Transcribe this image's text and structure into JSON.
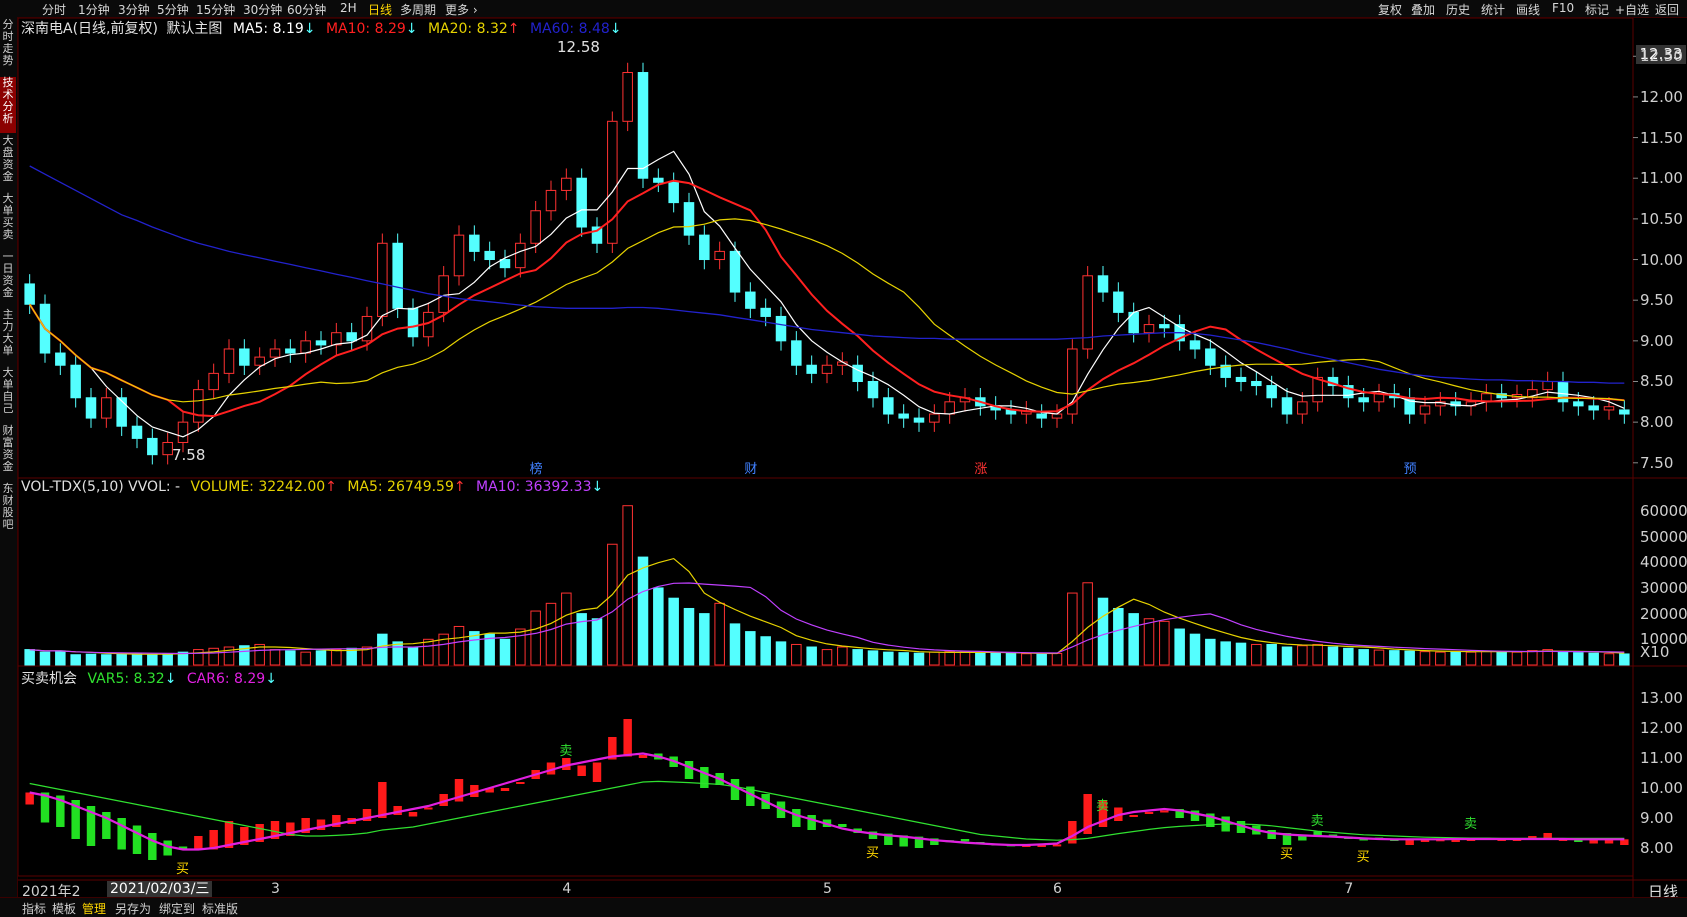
{
  "toolbar": {
    "left_tabs": [
      "分时",
      "1分钟",
      "3分钟",
      "5分钟",
      "15分钟",
      "30分钟",
      "60分钟",
      "2H",
      "日线",
      "多周期",
      "更多 ›"
    ],
    "active_tab": "日线",
    "right_buttons": [
      "复权",
      "叠加",
      "历史",
      "统计",
      "画线",
      "F10",
      "标记",
      "+自选",
      "返回"
    ]
  },
  "sidebar": {
    "items": [
      "分时走势",
      "技术分析",
      "大盘资金",
      "大单买卖",
      "一日资金",
      "主力大单",
      "大单自己",
      "财富资金",
      "东财股吧"
    ],
    "active": "技术分析"
  },
  "main_panel": {
    "stock_label": "深南电A(日线,前复权)",
    "theme_label": "默认主图",
    "ma5": "MA5: 8.19",
    "ma10": "MA10: 8.29",
    "ma20": "MA20: 8.32",
    "ma60": "MA60: 8.48",
    "max_label": "12.58",
    "min_label": "7.58",
    "current_price": "12.33",
    "y_ticks": [
      "12.50",
      "12.00",
      "11.50",
      "11.00",
      "10.50",
      "10.00",
      "9.50",
      "9.00",
      "8.50",
      "8.00",
      "7.50"
    ],
    "event_tags": [
      "榜",
      "财",
      "涨",
      "预"
    ]
  },
  "volume_panel": {
    "indicator": "VOL-TDX(5,10) VVOL: -",
    "volume": "VOLUME: 32242.00",
    "ma5": "MA5: 26749.59",
    "ma10": "MA10: 36392.33",
    "y_ticks": [
      "60000",
      "50000",
      "40000",
      "30000",
      "20000",
      "10000",
      "X10"
    ]
  },
  "signal_panel": {
    "indicator": "买卖机会",
    "var5": "VAR5: 8.32",
    "car6": "CAR6: 8.29",
    "y_ticks": [
      "13.00",
      "12.00",
      "11.00",
      "10.00",
      "9.00",
      "8.00"
    ],
    "buy_label": "买",
    "sell_label": "卖"
  },
  "x_axis": {
    "date_box": "2021/02/03/三",
    "labels": [
      "2021年2",
      "3",
      "4",
      "5",
      "6",
      "7"
    ],
    "period": "日线"
  },
  "bottom_bar": {
    "items": [
      "指标",
      "模板",
      "管理",
      "另存为",
      "绑定到",
      "标准版"
    ]
  },
  "colors": {
    "up": "#ff3232",
    "down": "#54ffff",
    "ma5": "#ffffff",
    "ma10": "#ff2020",
    "ma20": "#e6d200",
    "ma60": "#2222cc",
    "vol_ma5": "#e6d200",
    "vol_ma10": "#c040ff",
    "var5": "#30e030",
    "car6": "#e020e0",
    "grid": "#5a0000"
  },
  "chart_data": [
    {
      "type": "candlestick",
      "title": "深南电A(日线,前复权)",
      "y_range": [
        7.35,
        12.7
      ],
      "max": 12.58,
      "min": 7.58,
      "close": [
        9.45,
        8.85,
        8.7,
        8.3,
        8.05,
        8.3,
        7.95,
        7.8,
        7.6,
        7.75,
        8.0,
        8.4,
        8.6,
        8.9,
        8.7,
        8.8,
        8.9,
        8.85,
        9.0,
        8.95,
        9.1,
        9.0,
        9.3,
        10.2,
        9.4,
        9.05,
        9.35,
        9.8,
        10.3,
        10.1,
        10.0,
        9.9,
        10.2,
        10.6,
        10.85,
        11.0,
        10.4,
        10.2,
        11.7,
        12.3,
        11.0,
        10.95,
        10.7,
        10.3,
        10.0,
        10.1,
        9.6,
        9.4,
        9.3,
        9.0,
        8.7,
        8.6,
        8.7,
        8.7,
        8.5,
        8.3,
        8.1,
        8.05,
        8.0,
        8.1,
        8.25,
        8.3,
        8.2,
        8.15,
        8.1,
        8.1,
        8.05,
        8.1,
        8.9,
        9.8,
        9.6,
        9.35,
        9.1,
        9.2,
        9.2,
        9.0,
        8.9,
        8.7,
        8.55,
        8.5,
        8.45,
        8.3,
        8.1,
        8.25,
        8.55,
        8.45,
        8.3,
        8.25,
        8.35,
        8.3,
        8.1,
        8.2,
        8.25,
        8.2,
        8.25,
        8.35,
        8.3,
        8.3,
        8.4,
        8.5,
        8.25,
        8.2,
        8.15,
        8.15,
        8.1
      ],
      "ma60": [
        11.15,
        11.05,
        10.95,
        10.85,
        10.75,
        10.65,
        10.55,
        10.48,
        10.4,
        10.33,
        10.26,
        10.2,
        10.15,
        10.1,
        10.06,
        10.02,
        9.98,
        9.94,
        9.9,
        9.86,
        9.82,
        9.78,
        9.74,
        9.7,
        9.66,
        9.62,
        9.58,
        9.55,
        9.52,
        9.5,
        9.48,
        9.46,
        9.44,
        9.42,
        9.41,
        9.4,
        9.4,
        9.4,
        9.4,
        9.41,
        9.41,
        9.4,
        9.38,
        9.36,
        9.34,
        9.32,
        9.29,
        9.26,
        9.23,
        9.2,
        9.17,
        9.14,
        9.12,
        9.1,
        9.08,
        9.06,
        9.05,
        9.04,
        9.03,
        9.03,
        9.02,
        9.02,
        9.02,
        9.02,
        9.02,
        9.02,
        9.02,
        9.02,
        9.03,
        9.04,
        9.06,
        9.07,
        9.08,
        9.09,
        9.1,
        9.1,
        9.09,
        9.07,
        9.04,
        9.01,
        8.98,
        8.94,
        8.9,
        8.85,
        8.81,
        8.77,
        8.73,
        8.69,
        8.65,
        8.62,
        8.59,
        8.57,
        8.55,
        8.54,
        8.53,
        8.52,
        8.52,
        8.51,
        8.51,
        8.5,
        8.5,
        8.49,
        8.49,
        8.48,
        8.48
      ]
    },
    {
      "type": "bar",
      "title": "VOL-TDX(5,10)",
      "y_range": [
        0,
        65000
      ],
      "up_flags": [
        0,
        0,
        0,
        0,
        0,
        0,
        0,
        0,
        0,
        0,
        0,
        1,
        1,
        1,
        0,
        1,
        1,
        0,
        1,
        0,
        1,
        0,
        1,
        0,
        0,
        0,
        1,
        1,
        1,
        0,
        0,
        0,
        1,
        1,
        1,
        1,
        0,
        0,
        1,
        1,
        0,
        0,
        0,
        0,
        0,
        1,
        0,
        0,
        0,
        0,
        1,
        0,
        1,
        1,
        0,
        0,
        0,
        0,
        0,
        1,
        1,
        1,
        0,
        0,
        0,
        1,
        0,
        1,
        1,
        1,
        0,
        0,
        0,
        1,
        1,
        0,
        0,
        0,
        0,
        0,
        1,
        0,
        0,
        1,
        1,
        0,
        0,
        0,
        1,
        0,
        0,
        1,
        1,
        0,
        1,
        1,
        0,
        1,
        1,
        1,
        0,
        0,
        0,
        1,
        0
      ],
      "volume": [
        6000,
        5000,
        5500,
        4000,
        4200,
        4000,
        4300,
        4500,
        4000,
        4200,
        5000,
        6000,
        6500,
        7000,
        7500,
        8000,
        6000,
        5500,
        5000,
        5500,
        6000,
        6500,
        7000,
        12000,
        9000,
        7000,
        10000,
        12000,
        15000,
        13000,
        12000,
        10000,
        14000,
        21000,
        24000,
        28000,
        20000,
        18000,
        47000,
        62000,
        42000,
        30000,
        26000,
        22000,
        20000,
        24000,
        16000,
        13000,
        11000,
        9000,
        8000,
        7000,
        6000,
        7000,
        6000,
        5500,
        5000,
        4800,
        4600,
        5000,
        5200,
        5000,
        4800,
        4600,
        4500,
        4400,
        4300,
        4500,
        28000,
        32000,
        26000,
        22000,
        20000,
        18000,
        17000,
        14000,
        12000,
        10000,
        9000,
        8500,
        8000,
        8000,
        7000,
        7500,
        8000,
        7000,
        6500,
        6000,
        5800,
        5600,
        5400,
        5200,
        5000,
        5200,
        5000,
        5400,
        5200,
        5000,
        5600,
        6000,
        5000,
        4800,
        4600,
        4400,
        4300
      ]
    },
    {
      "type": "line",
      "title": "买卖机会",
      "y_range": [
        7.0,
        13.5
      ],
      "series": [
        {
          "name": "VAR5",
          "values": [
            10.15,
            10.05,
            9.95,
            9.85,
            9.75,
            9.65,
            9.55,
            9.45,
            9.35,
            9.25,
            9.15,
            9.05,
            8.95,
            8.85,
            8.75,
            8.65,
            8.55,
            8.45,
            8.4,
            8.4,
            8.42,
            8.45,
            8.5,
            8.6,
            8.65,
            8.7,
            8.8,
            8.9,
            9.0,
            9.1,
            9.2,
            9.3,
            9.4,
            9.5,
            9.6,
            9.7,
            9.8,
            9.9,
            10.0,
            10.1,
            10.2,
            10.22,
            10.2,
            10.18,
            10.15,
            10.12,
            10.05,
            9.95,
            9.85,
            9.75,
            9.65,
            9.55,
            9.45,
            9.35,
            9.25,
            9.15,
            9.05,
            8.95,
            8.85,
            8.75,
            8.65,
            8.55,
            8.45,
            8.4,
            8.35,
            8.3,
            8.28,
            8.26,
            8.28,
            8.32,
            8.4,
            8.48,
            8.55,
            8.62,
            8.68,
            8.72,
            8.75,
            8.78,
            8.8,
            8.8,
            8.78,
            8.74,
            8.68,
            8.62,
            8.56,
            8.52,
            8.48,
            8.44,
            8.42,
            8.4,
            8.38,
            8.36,
            8.35,
            8.34,
            8.33,
            8.33,
            8.32,
            8.32,
            8.32,
            8.32,
            8.32,
            8.32,
            8.32,
            8.32,
            8.32
          ]
        },
        {
          "name": "CAR6",
          "values": [
            9.85,
            9.75,
            9.6,
            9.4,
            9.2,
            9.0,
            8.75,
            8.5,
            8.25,
            8.05,
            7.95,
            7.95,
            8.0,
            8.1,
            8.2,
            8.3,
            8.4,
            8.5,
            8.6,
            8.7,
            8.8,
            8.9,
            9.0,
            9.1,
            9.2,
            9.3,
            9.4,
            9.55,
            9.7,
            9.85,
            10.0,
            10.15,
            10.3,
            10.45,
            10.6,
            10.75,
            10.85,
            10.95,
            11.05,
            11.1,
            11.15,
            11.05,
            10.9,
            10.7,
            10.5,
            10.3,
            10.05,
            9.8,
            9.55,
            9.3,
            9.1,
            8.95,
            8.8,
            8.65,
            8.55,
            8.48,
            8.42,
            8.38,
            8.32,
            8.26,
            8.22,
            8.18,
            8.15,
            8.12,
            8.1,
            8.1,
            8.12,
            8.15,
            8.4,
            8.7,
            8.9,
            9.1,
            9.2,
            9.25,
            9.3,
            9.25,
            9.15,
            9.05,
            8.9,
            8.75,
            8.6,
            8.5,
            8.45,
            8.42,
            8.4,
            8.38,
            8.35,
            8.32,
            8.3,
            8.29,
            8.29,
            8.29,
            8.29,
            8.3,
            8.3,
            8.3,
            8.3,
            8.3,
            8.3,
            8.3,
            8.3,
            8.29,
            8.29,
            8.29,
            8.29
          ]
        }
      ]
    }
  ]
}
